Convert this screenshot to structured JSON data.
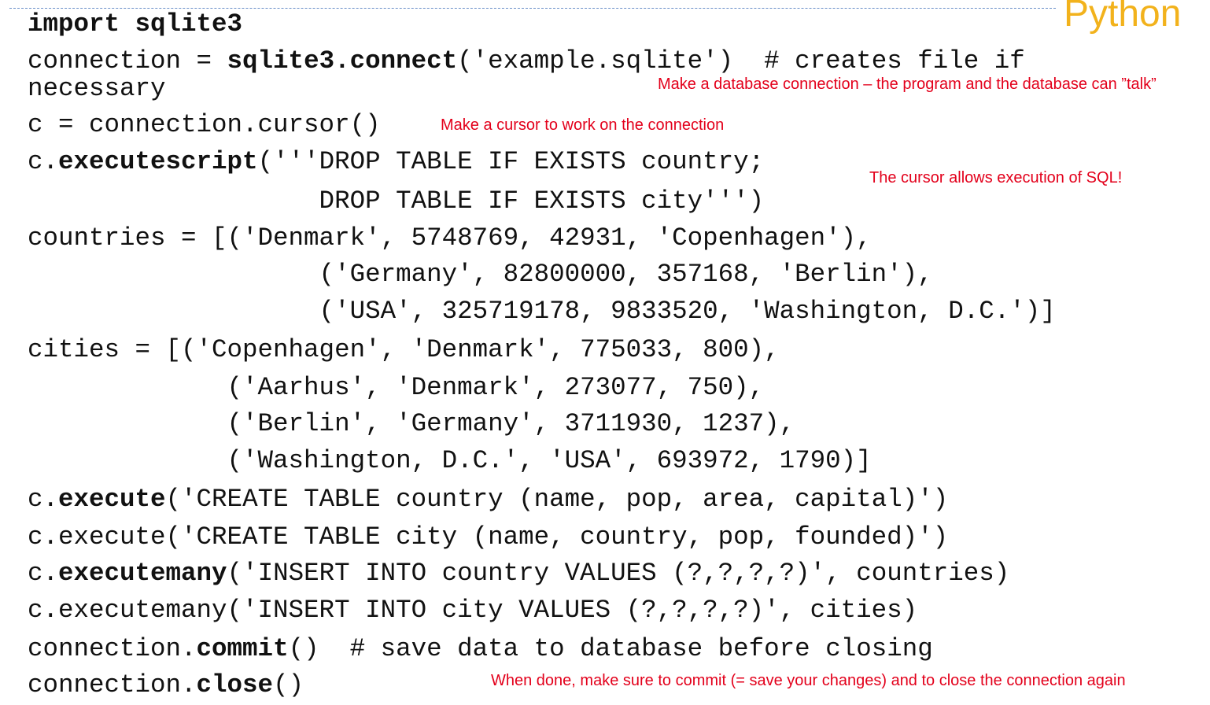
{
  "brand": "Python",
  "code": {
    "l1": "import sqlite3",
    "l2a": "connection = ",
    "l2b": "sqlite3.connect",
    "l2c": "('example.sqlite')  # creates file if",
    "l3": "necessary",
    "l4": "c = connection.cursor()",
    "l5a": "c.",
    "l5b": "executescript",
    "l5c": "('''DROP TABLE IF EXISTS country;",
    "l6": "                   DROP TABLE IF EXISTS city''')",
    "l7": "countries = [('Denmark', 5748769, 42931, 'Copenhagen'),",
    "l8": "                   ('Germany', 82800000, 357168, 'Berlin'),",
    "l9": "                   ('USA', 325719178, 9833520, 'Washington, D.C.')]",
    "l10": "cities = [('Copenhagen', 'Denmark', 775033, 800),",
    "l11": "             ('Aarhus', 'Denmark', 273077, 750),",
    "l12": "             ('Berlin', 'Germany', 3711930, 1237),",
    "l13": "             ('Washington, D.C.', 'USA', 693972, 1790)]",
    "l14a": "c.",
    "l14b": "execute",
    "l14c": "('CREATE TABLE country (name, pop, area, capital)')",
    "l15": "c.execute('CREATE TABLE city (name, country, pop, founded)')",
    "l16a": "c.",
    "l16b": "executemany",
    "l16c": "('INSERT INTO country VALUES (?,?,?,?)', countries)",
    "l17": "c.executemany('INSERT INTO city VALUES (?,?,?,?)', cities)",
    "l18a": "connection.",
    "l18b": "commit",
    "l18c": "()  # save data to database before closing",
    "l19a": "connection.",
    "l19b": "close",
    "l19c": "()"
  },
  "notes": {
    "connection": "Make a database connection – the program and the database can ”talk”",
    "cursor": "Make a cursor to work on the connection",
    "sql": "The cursor allows execution of SQL!",
    "commit": "When done, make sure to commit (= save your changes) and to close the connection again"
  },
  "colors": {
    "accent": "#f2b21c",
    "note": "#e3001b",
    "rule": "#6a8fc8"
  }
}
